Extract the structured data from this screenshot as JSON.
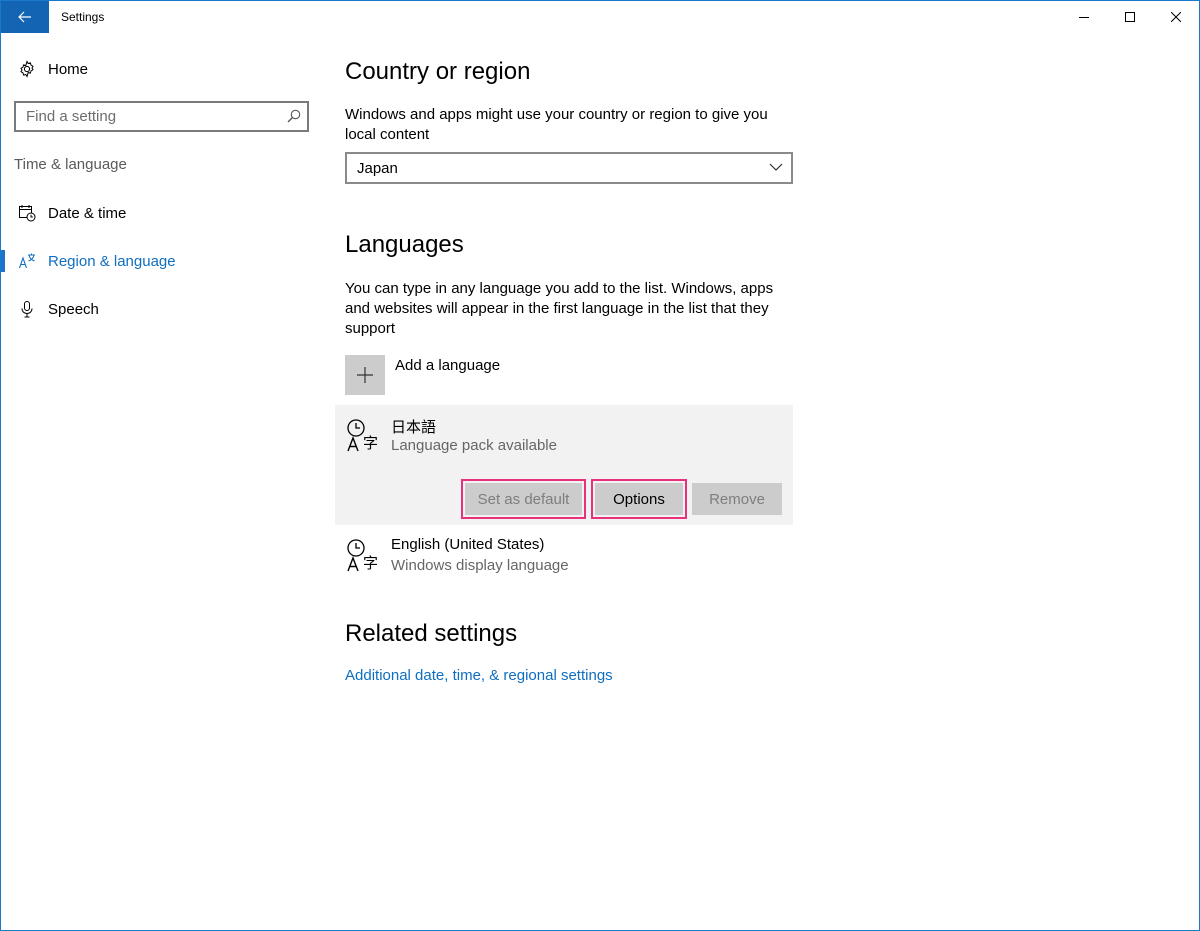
{
  "window": {
    "title": "Settings",
    "icons": {
      "back": "back-arrow-icon",
      "minimize": "minimize-icon",
      "maximize": "maximize-icon",
      "close": "close-icon"
    }
  },
  "sidebar": {
    "home_label": "Home",
    "search_placeholder": "Find a setting",
    "section_label": "Time & language",
    "items": [
      {
        "label": "Date & time",
        "icon": "calendar-clock-icon",
        "active": false
      },
      {
        "label": "Region & language",
        "icon": "region-language-icon",
        "active": true
      },
      {
        "label": "Speech",
        "icon": "microphone-icon",
        "active": false
      }
    ]
  },
  "main": {
    "country": {
      "heading": "Country or region",
      "description": "Windows and apps might use your country or region to give you local content",
      "selected": "Japan"
    },
    "languages": {
      "heading": "Languages",
      "description": "You can type in any language you add to the list. Windows, apps and websites will appear in the first language in the list that they support",
      "add_label": "Add a language",
      "list": [
        {
          "name": "日本語",
          "status": "Language pack available",
          "selected": true
        },
        {
          "name": "English (United States)",
          "status": "Windows display language",
          "selected": false
        }
      ],
      "buttons": {
        "set_default": "Set as default",
        "options": "Options",
        "remove": "Remove"
      }
    },
    "related": {
      "heading": "Related settings",
      "link": "Additional date, time, & regional settings"
    }
  },
  "colors": {
    "accent": "#0f6ebf",
    "titlebar_back": "#1464b4",
    "highlight": "#e8317a",
    "selected_row": "#f2f2f2",
    "button": "#cccccc"
  }
}
